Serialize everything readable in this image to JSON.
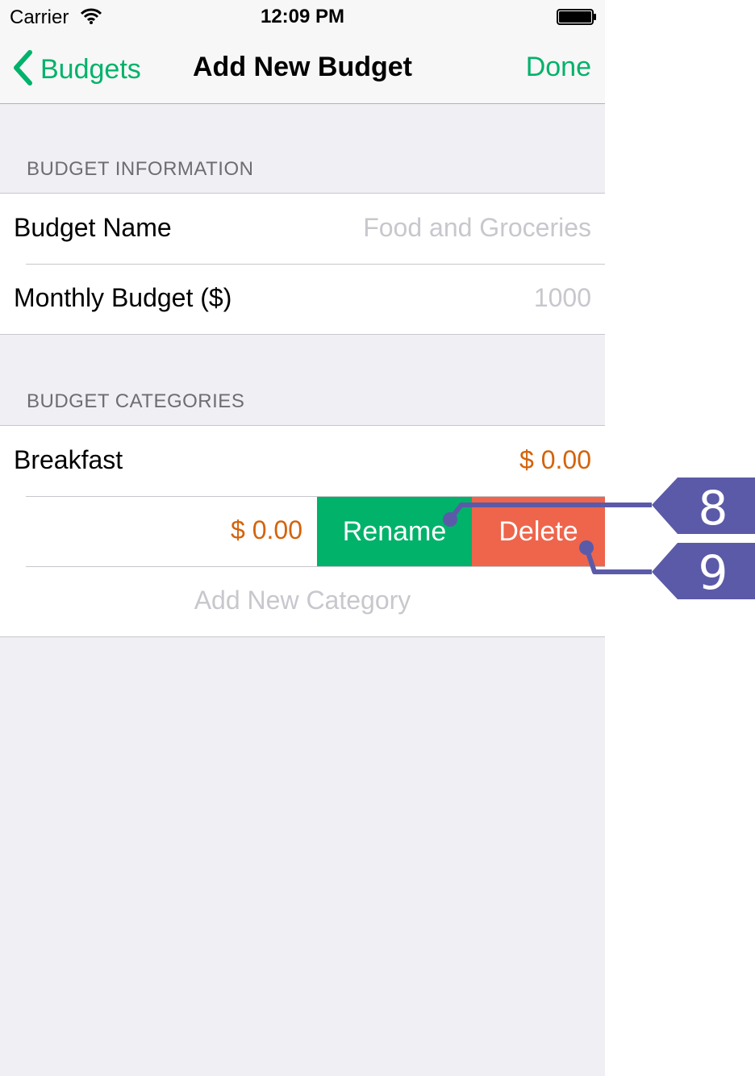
{
  "status_bar": {
    "carrier": "Carrier",
    "time": "12:09 PM",
    "icons": [
      "wifi-icon",
      "battery-icon"
    ]
  },
  "nav": {
    "back_label": "Budgets",
    "title": "Add New Budget",
    "done_label": "Done",
    "accent_color": "#00b26a"
  },
  "sections": {
    "info": {
      "header": "BUDGET INFORMATION",
      "rows": [
        {
          "label": "Budget Name",
          "placeholder": "Food and Groceries"
        },
        {
          "label": "Monthly Budget ($)",
          "placeholder": "1000"
        }
      ]
    },
    "categories": {
      "header": "BUDGET CATEGORIES",
      "items": [
        {
          "label": "Breakfast",
          "amount": "$ 0.00"
        },
        {
          "amount": "$ 0.00",
          "actions": {
            "rename": "Rename",
            "delete": "Delete"
          }
        }
      ],
      "add_label": "Add New Category"
    }
  },
  "callouts": [
    {
      "number": "8",
      "target": "Rename"
    },
    {
      "number": "9",
      "target": "Delete"
    }
  ],
  "colors": {
    "amount": "#d4630b",
    "rename": "#00b26a",
    "delete": "#ee654b",
    "callout": "#5b5aa8"
  }
}
